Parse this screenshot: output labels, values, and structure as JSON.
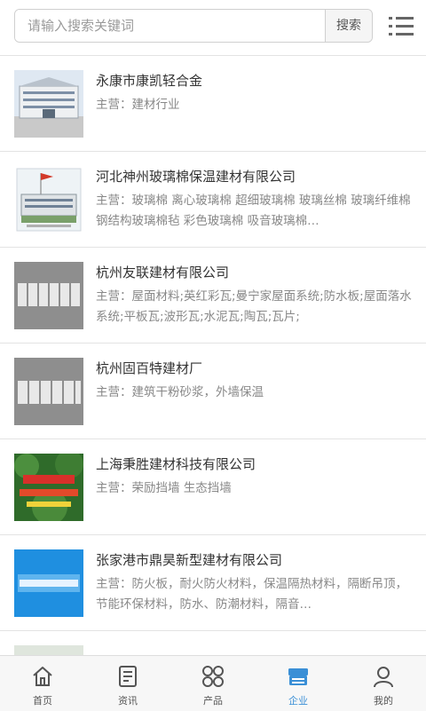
{
  "search": {
    "placeholder": "请输入搜索关键词",
    "button_label": "搜索"
  },
  "companies": [
    {
      "name": "永康市康凯轻合金",
      "desc": "主营：建材行业",
      "thumb": "building-photo"
    },
    {
      "name": "河北神州玻璃棉保温建材有限公司",
      "desc": "主营：玻璃棉 离心玻璃棉 超细玻璃棉 玻璃丝棉 玻璃纤维棉 钢结构玻璃棉毡 彩色玻璃棉 吸音玻璃棉…",
      "thumb": "factory-photo"
    },
    {
      "name": "杭州友联建材有限公司",
      "desc": "主营：屋面材料;英红彩瓦;曼宁家屋面系统;防水板;屋面落水系统;平板瓦;波形瓦;水泥瓦;陶瓦;瓦片;",
      "thumb": "gray-text-logo"
    },
    {
      "name": "杭州固百特建材厂",
      "desc": "主营：建筑干粉砂浆，外墙保温",
      "thumb": "gray-text-logo"
    },
    {
      "name": "上海秉胜建材科技有限公司",
      "desc": "主营：荣励挡墙 生态挡墙",
      "thumb": "green-wall-photo"
    },
    {
      "name": "张家港市鼎昊新型建材有限公司",
      "desc": "主营：防火板，耐火防火材料，保温隔热材料，隔断吊顶，节能环保材料，防水、防潮材料，隔音…",
      "thumb": "blue-text-logo"
    }
  ],
  "tabbar": {
    "items": [
      {
        "label": "首页",
        "icon": "home-icon"
      },
      {
        "label": "资讯",
        "icon": "news-icon"
      },
      {
        "label": "产品",
        "icon": "grid-icon"
      },
      {
        "label": "企业",
        "icon": "company-icon",
        "active": true
      },
      {
        "label": "我的",
        "icon": "user-icon"
      }
    ],
    "active_color": "#3a8fd6"
  }
}
